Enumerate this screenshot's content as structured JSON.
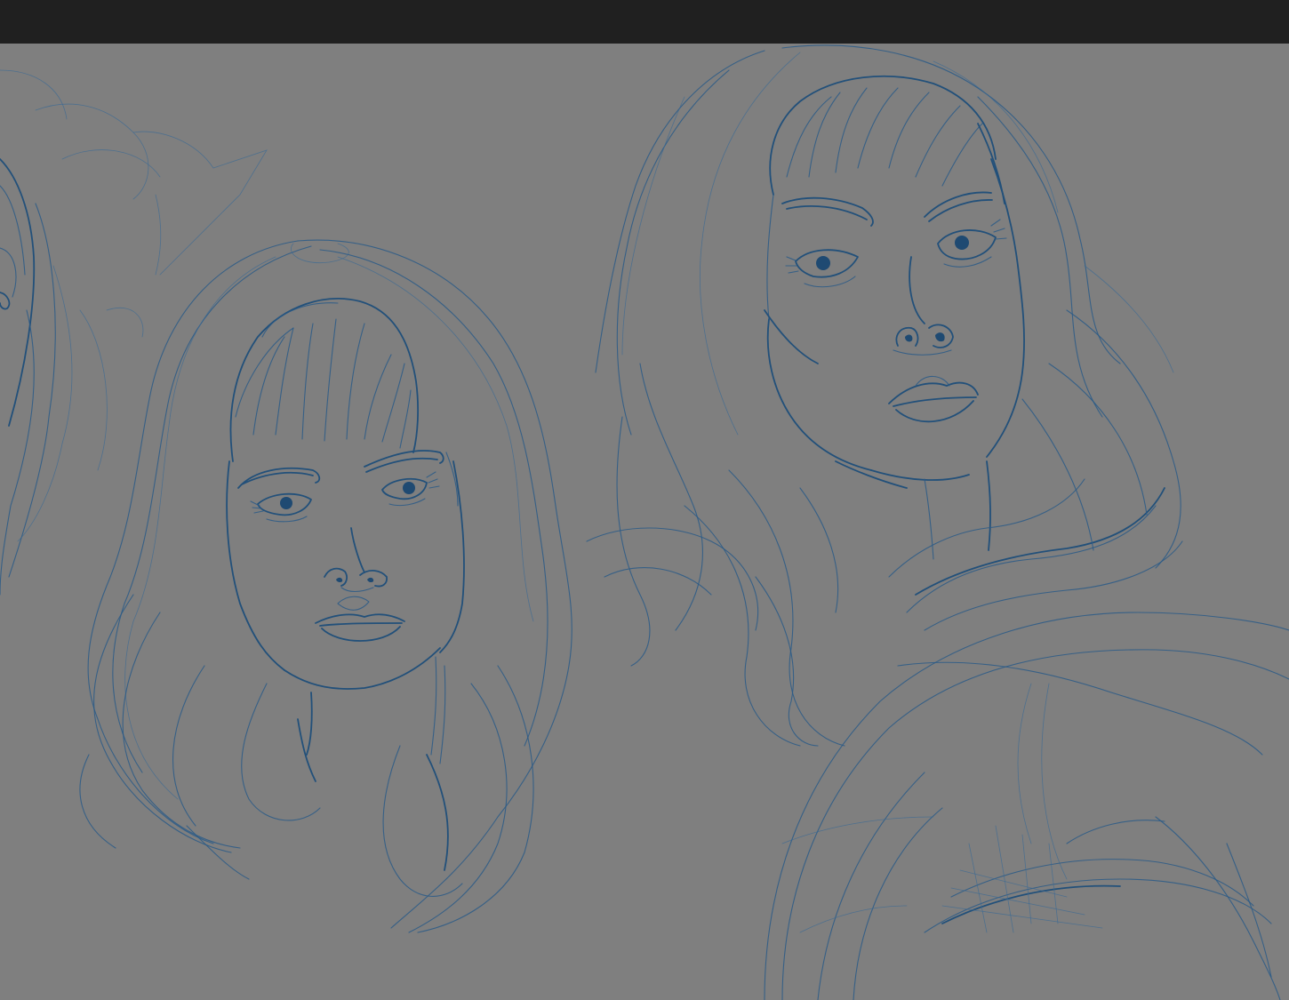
{
  "app": {
    "top_bar_color": "#202020",
    "canvas_color": "#7f7f7f",
    "ink_color": "#2a5b87"
  },
  "canvas": {
    "artwork": "sketch-layer"
  }
}
